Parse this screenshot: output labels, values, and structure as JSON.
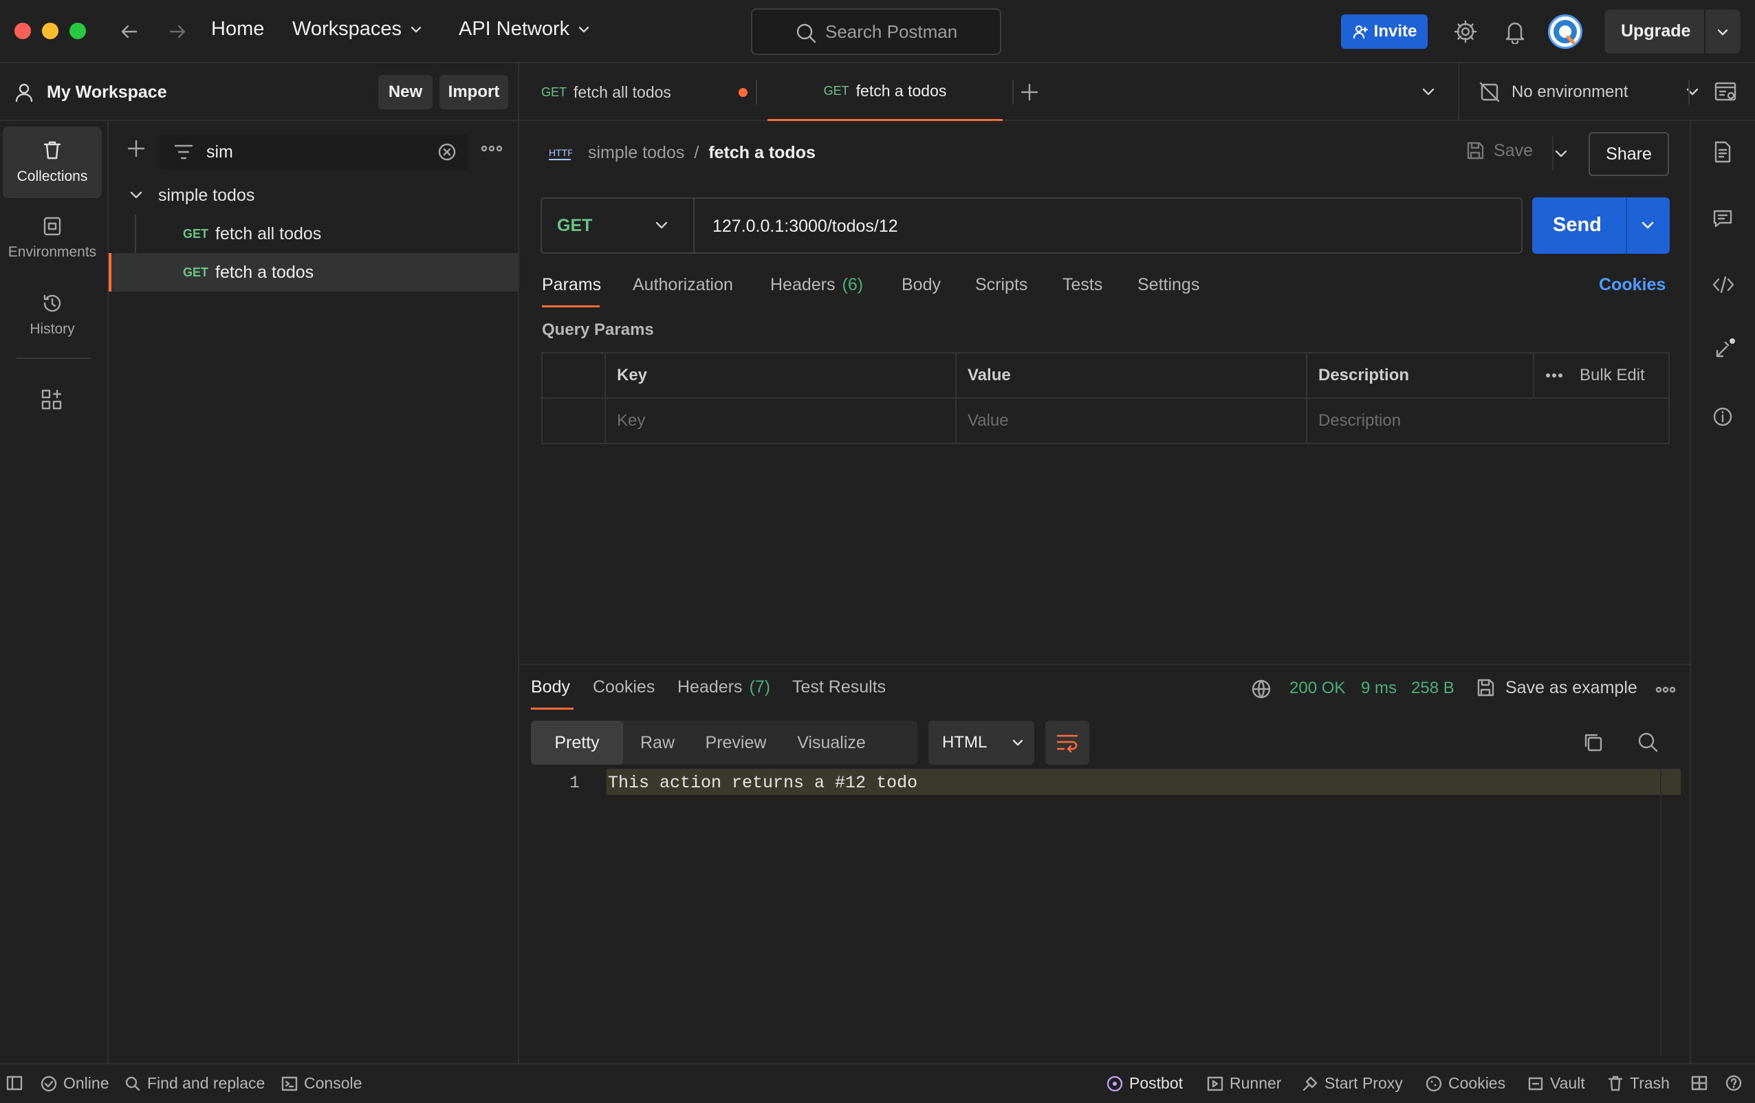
{
  "topbar": {
    "home": "Home",
    "workspaces": "Workspaces",
    "api_network": "API Network",
    "search_placeholder": "Search Postman",
    "invite": "Invite",
    "upgrade": "Upgrade"
  },
  "workspace": {
    "name": "My Workspace",
    "new_label": "New",
    "import_label": "Import"
  },
  "rail": {
    "collections": "Collections",
    "environments": "Environments",
    "history": "History"
  },
  "sidebar": {
    "filter_value": "sim",
    "collection_name": "simple todos",
    "items": [
      {
        "method": "GET",
        "name": "fetch all todos"
      },
      {
        "method": "GET",
        "name": "fetch a todos"
      }
    ]
  },
  "tabs": [
    {
      "method": "GET",
      "name": "fetch all todos"
    },
    {
      "method": "GET",
      "name": "fetch a todos"
    }
  ],
  "environment": "No environment",
  "request": {
    "breadcrumb_collection": "simple todos",
    "breadcrumb_sep": "/",
    "breadcrumb_request": "fetch a todos",
    "save_label": "Save",
    "share_label": "Share",
    "method": "GET",
    "url": "127.0.0.1:3000/todos/12",
    "send_label": "Send",
    "tabs": {
      "params": "Params",
      "authorization": "Authorization",
      "headers": "Headers",
      "headers_count": "(6)",
      "body": "Body",
      "scripts": "Scripts",
      "tests": "Tests",
      "settings": "Settings"
    },
    "cookies_label": "Cookies",
    "query_params_title": "Query Params",
    "table": {
      "key_header": "Key",
      "value_header": "Value",
      "description_header": "Description",
      "bulk_edit": "Bulk Edit",
      "key_placeholder": "Key",
      "value_placeholder": "Value",
      "description_placeholder": "Description"
    }
  },
  "response": {
    "tabs": {
      "body": "Body",
      "cookies": "Cookies",
      "headers": "Headers",
      "headers_count": "(7)",
      "test_results": "Test Results"
    },
    "status": "200 OK",
    "time": "9 ms",
    "size": "258 B",
    "save_as_example": "Save as example",
    "views": {
      "pretty": "Pretty",
      "raw": "Raw",
      "preview": "Preview",
      "visualize": "Visualize"
    },
    "format": "HTML",
    "line_number": "1",
    "line_text": "This action returns a #12 todo"
  },
  "statusbar": {
    "online": "Online",
    "find_replace": "Find and replace",
    "console": "Console",
    "postbot": "Postbot",
    "runner": "Runner",
    "start_proxy": "Start Proxy",
    "cookies": "Cookies",
    "vault": "Vault",
    "trash": "Trash"
  },
  "colors": {
    "accent": "#ff6c37",
    "primary_blue": "#1d62d6",
    "method_green": "#6bc48a",
    "status_green": "#49b07a",
    "link_blue": "#4d9cff"
  }
}
